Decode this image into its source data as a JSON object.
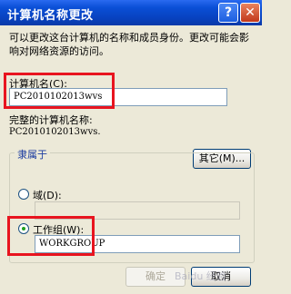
{
  "window": {
    "title": "计算机名称更改",
    "help_label": "?",
    "close_label": "✕"
  },
  "description": "可以更改这台计算机的名称和成员身份。更改可能会影响对网络资源的访问。",
  "computer_name": {
    "label": "计算机名(C):",
    "value": "PC2010102013wvs"
  },
  "full_name": {
    "label": "完整的计算机名称:",
    "value": "PC2010102013wvs."
  },
  "other_button": "其它(M)...",
  "member_of": {
    "legend": "隶属于",
    "domain": {
      "label": "域(D):",
      "value": "",
      "selected": false
    },
    "workgroup": {
      "label": "工作组(W):",
      "value": "WORKGROUP",
      "selected": true
    }
  },
  "buttons": {
    "ok": "确定",
    "cancel": "取消"
  },
  "watermark": "Baidu 经验",
  "highlight_color": "#e8141f"
}
